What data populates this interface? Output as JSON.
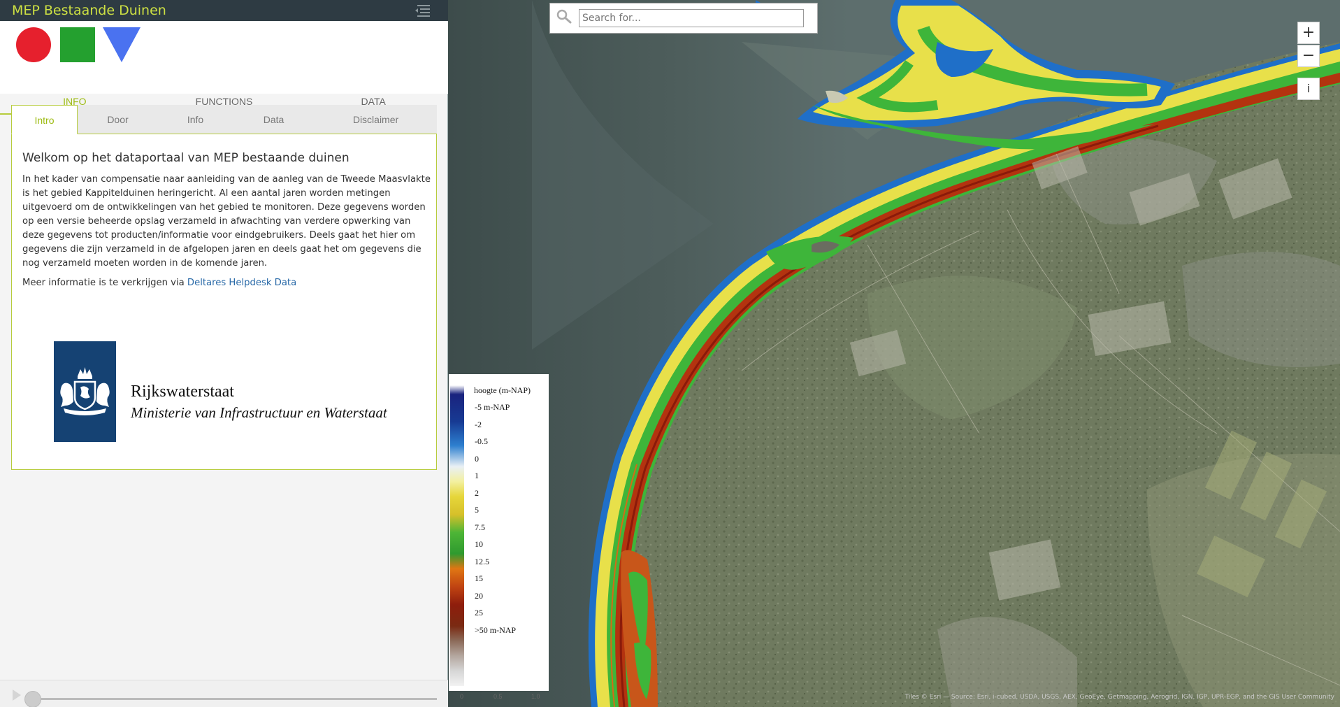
{
  "app": {
    "title": "MEP Bestaande Duinen"
  },
  "main_tabs": [
    {
      "label": "INFO"
    },
    {
      "label": "FUNCTIONS"
    },
    {
      "label": "DATA"
    }
  ],
  "sub_tabs": [
    {
      "label": "Intro"
    },
    {
      "label": "Door"
    },
    {
      "label": "Info"
    },
    {
      "label": "Data"
    },
    {
      "label": "Disclaimer"
    }
  ],
  "content": {
    "heading": "Welkom op het dataportaal van MEP bestaande duinen",
    "paragraph": "In het kader van compensatie naar aanleiding van de aanleg van de Tweede Maasvlakte is het gebied Kappitelduinen heringericht. Al een aantal jaren worden metingen uitgevoerd om de ontwikkelingen van het gebied te monitoren. Deze gegevens worden op een versie beheerde opslag verzameld in afwachting van verdere opwerking van deze gegevens tot producten/informatie voor eindgebruikers. Deels gaat het hier om gegevens die zijn verzameld in de afgelopen jaren en deels gaat het om gegevens die nog verzameld moeten worden in de komende jaren.",
    "more_prefix": "Meer informatie is te verkrijgen via ",
    "more_link": "Deltares Helpdesk Data"
  },
  "logo": {
    "name": "Rijkswaterstaat",
    "ministry": "Ministerie van Infrastructuur en Waterstaat"
  },
  "search": {
    "placeholder": "Search for..."
  },
  "map_controls": {
    "zoom_in": "+",
    "zoom_out": "−",
    "info": "i"
  },
  "legend": {
    "title": "hoogte (m-NAP)",
    "labels": [
      "-5 m-NAP",
      "-2",
      "-0.5",
      "0",
      "1",
      "2",
      "5",
      "7.5",
      "10",
      "12.5",
      "15",
      "20",
      "25",
      ">50 m-NAP"
    ],
    "scale_labels": [
      "0",
      "0.5",
      "1.0"
    ]
  },
  "attribution": "Tiles © Esri — Source: Esri, i-cubed, USDA, USGS, AEX, GeoEye, Getmapping, Aerogrid, IGN, IGP, UPR-EGP, and the GIS User Community",
  "colors": {
    "accent": "#9dbb12",
    "titlebar": "#2e3b43",
    "shape_circle": "#e6202d",
    "shape_square": "#24a02f",
    "shape_triangle": "#4a72f0",
    "rws_blue": "#154273"
  },
  "icons": [
    "menu-icon",
    "search-icon",
    "play-icon"
  ]
}
